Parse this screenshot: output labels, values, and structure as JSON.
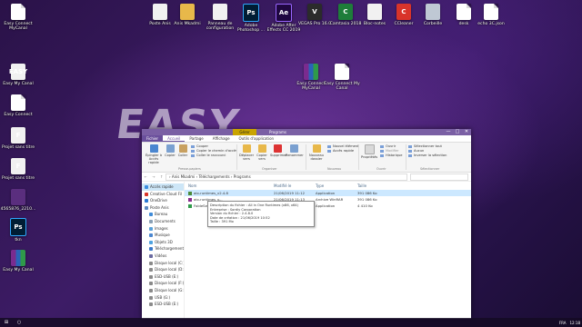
{
  "desktop": {
    "icons": [
      {
        "label": "Easy Connect MyCanal",
        "glyph": "",
        "style": "g-file"
      },
      {
        "label": "Easy My Canal",
        "glyph": "EASY",
        "style": "g-white"
      },
      {
        "label": "Easy Connect",
        "glyph": "",
        "style": "g-file"
      },
      {
        "label": "Projet sans titre",
        "glyph": "F",
        "style": "g-white"
      },
      {
        "label": "Projet sans titre",
        "glyph": "F",
        "style": "g-white"
      },
      {
        "label": "4565876_2210...",
        "glyph": "",
        "style": "g-notes"
      },
      {
        "label": "tkn",
        "glyph": "Ps",
        "style": "g-ps"
      },
      {
        "label": "Easy My Canal",
        "glyph": "",
        "style": "g-rar"
      },
      {
        "label": "Poste Anis",
        "glyph": "",
        "style": "g-white"
      },
      {
        "label": "Anis Mkadmi",
        "glyph": "",
        "style": "g-folder"
      },
      {
        "label": "Panneau de configuration",
        "glyph": "",
        "style": "g-white"
      },
      {
        "label": "Adobe Photoshop ...",
        "glyph": "Ps",
        "style": "g-ps"
      },
      {
        "label": "Adobe After Effects CC 2019",
        "glyph": "Ae",
        "style": "g-ae"
      },
      {
        "label": "VEGAS Pro 16.0",
        "glyph": "V",
        "style": "g-vegas"
      },
      {
        "label": "Camtasia 2018",
        "glyph": "C",
        "style": "g-cam"
      },
      {
        "label": "Bloc-notes",
        "glyph": "",
        "style": "g-white"
      },
      {
        "label": "CCleaner",
        "glyph": "C",
        "style": "g-ccl"
      },
      {
        "label": "Corbeille",
        "glyph": "",
        "style": "g-bin"
      },
      {
        "label": "desk",
        "glyph": "",
        "style": "g-file"
      },
      {
        "label": "echo 3C.json",
        "glyph": "",
        "style": "g-file"
      },
      {
        "label": "Easy Connect MyCanal",
        "glyph": "",
        "style": "g-rar"
      },
      {
        "label": "Easy Connect My Canal",
        "glyph": "",
        "style": "g-file"
      }
    ],
    "watermark": "EASY"
  },
  "explorer": {
    "context_tab": "Gérer",
    "title": "Programs",
    "window_controls": [
      "—",
      "□",
      "✕"
    ],
    "tabs": [
      "Fichier",
      "Accueil",
      "Partage",
      "Affichage",
      "Outils d'application"
    ],
    "ribbon": {
      "pin_label": "Épingler à Accès rapide",
      "copy_label": "Copier",
      "paste_label": "Coller",
      "cut": "Couper",
      "copy_path": "Copier le chemin d'accès",
      "paste_shortcut": "Coller le raccourci",
      "clipboard_group": "Presse-papiers",
      "move_label": "Déplacer vers",
      "copyto_label": "Copier vers",
      "delete_label": "Supprimer",
      "rename_label": "Renommer",
      "organize_group": "Organiser",
      "new_folder_label": "Nouveau dossier",
      "new_item": "Nouvel élément",
      "easy_access": "Accès rapide",
      "new_group": "Nouveau",
      "properties_label": "Propriétés",
      "open": "Ouvrir",
      "modify": "Modifier",
      "history": "Historique",
      "open_group": "Ouvrir",
      "select_all": "Sélectionner tout",
      "select_none": "Aucun",
      "invert": "Inverser la sélection",
      "select_group": "Sélectionner"
    },
    "address": {
      "path": "›  Anis Mkadmi  ›  Téléchargements  ›  Programs",
      "search_placeholder": ""
    },
    "nav_items": [
      {
        "label": "Accès rapide",
        "color": "#3b8ee0",
        "sub": false,
        "sel": true
      },
      {
        "label": "Creative Cloud Fil",
        "color": "#d9342a",
        "sub": false,
        "sel": false
      },
      {
        "label": "OneDrive",
        "color": "#2a7ad5",
        "sub": false,
        "sel": false
      },
      {
        "label": "Poste Anis",
        "color": "#5c8ac2",
        "sub": false,
        "sel": false
      },
      {
        "label": "Bureau",
        "color": "#3f8bd8",
        "sub": true,
        "sel": false
      },
      {
        "label": "Documents",
        "color": "#8aa0b5",
        "sub": true,
        "sel": false
      },
      {
        "label": "Images",
        "color": "#58a0d8",
        "sub": true,
        "sel": false
      },
      {
        "label": "Musique",
        "color": "#4a86d0",
        "sub": true,
        "sel": false
      },
      {
        "label": "Objets 3D",
        "color": "#4fa3e0",
        "sub": true,
        "sel": false
      },
      {
        "label": "Téléchargement",
        "color": "#3a78c8",
        "sub": true,
        "sel": false
      },
      {
        "label": "Vidéos",
        "color": "#6a6aa0",
        "sub": true,
        "sel": false
      },
      {
        "label": "Disque local (C:)",
        "color": "#8a8a8a",
        "sub": true,
        "sel": false
      },
      {
        "label": "Disque local (D:)",
        "color": "#8a8a8a",
        "sub": true,
        "sel": false
      },
      {
        "label": "ESD-USB (E:)",
        "color": "#8a8a8a",
        "sub": true,
        "sel": false
      },
      {
        "label": "Disque local (F:)",
        "color": "#8a8a8a",
        "sub": true,
        "sel": false
      },
      {
        "label": "Disque local (G:)",
        "color": "#8a8a8a",
        "sub": true,
        "sel": false
      },
      {
        "label": "USB (G:)",
        "color": "#8a8a8a",
        "sub": true,
        "sel": false
      },
      {
        "label": "ESD-USB (E:)",
        "color": "#8a8a8a",
        "sub": true,
        "sel": false
      }
    ],
    "columns": [
      "Nom",
      "Modifié le",
      "Type",
      "Taille"
    ],
    "files": [
      {
        "name": "aio-runtimes_v2.4.8",
        "modified": "21/06/2019 11:12",
        "type": "Application",
        "size": "391 086 Ko",
        "sel": true,
        "color": "#4a8a3a"
      },
      {
        "name": "aio-runtimes_v...",
        "modified": "21/06/2019 11:13",
        "type": "Archive WinRAR",
        "size": "391 086 Ko",
        "sel": false,
        "color": "#8a2b8f"
      },
      {
        "name": "FoldeSetup",
        "modified": "21/06/2019 22:40",
        "type": "Application",
        "size": "4 410 Ko",
        "sel": false,
        "color": "#2f9a4a"
      }
    ],
    "tooltip": [
      "Description du fichier : All in One Runtimes (x86, x64)",
      "Entreprise : Sordiy Corporation",
      "Version du fichier : 2.4.8.0",
      "Date de création : 21/06/2019 10:52",
      "Taille : 391 Mo"
    ]
  },
  "taskbar": {
    "time": "12:18",
    "lang": "FRA"
  }
}
